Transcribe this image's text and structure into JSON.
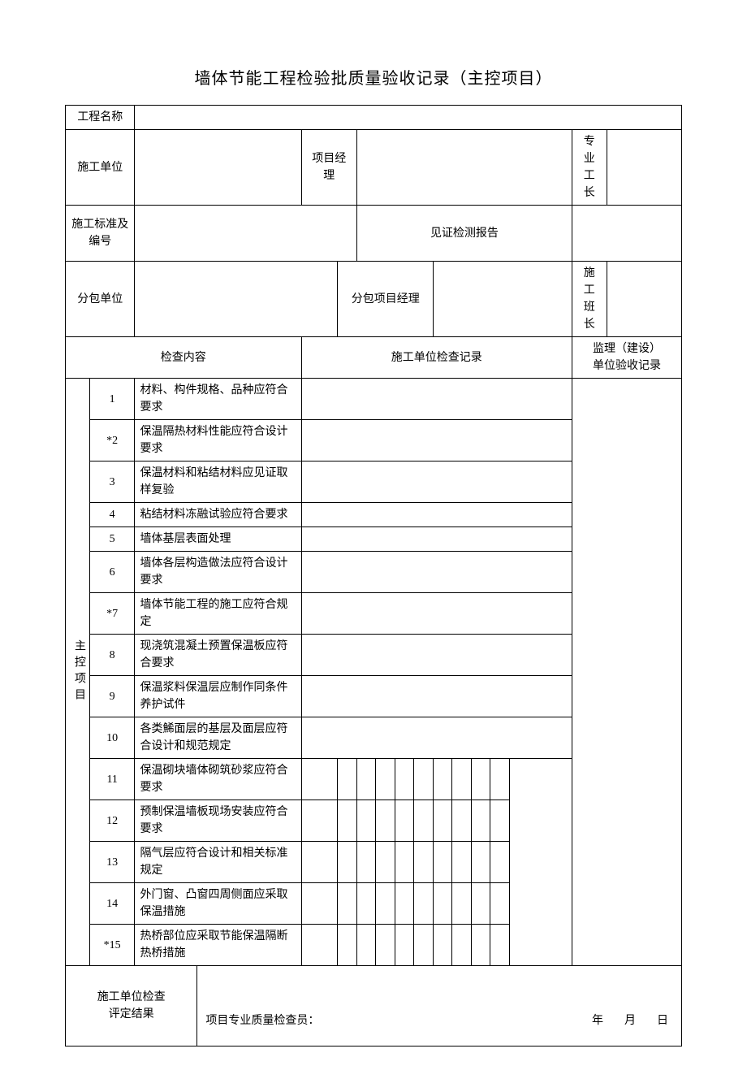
{
  "title": "墙体节能工程检验批质量验收记录（主控项目）",
  "labels": {
    "project_name": "工程名称",
    "construction_unit": "施工单位",
    "project_manager": "项目经理",
    "foreman": "专 业\n工 长",
    "standard_no": "施工标准及编号",
    "witness_report": "见证检测报告",
    "subcontract_unit": "分包单位",
    "sub_project_manager": "分包项目经理",
    "team_leader": "施 工\n班 长",
    "inspection_content": "检查内容",
    "unit_record": "施工单位检查记录",
    "supervisor_record": "监理（建设）\n单位验收记录",
    "main_items": "主控项目",
    "construction_check_result": "施工单位检查\n评定结果",
    "quality_inspector": "项目专业质量检查员：",
    "date": "年　月　日"
  },
  "items": [
    {
      "no": "1",
      "content": "材料、构件规格、品种应符合要求"
    },
    {
      "no": "*2",
      "content": "保温隔热材料性能应符合设计要求"
    },
    {
      "no": "3",
      "content": "保温材料和粘结材料应见证取样复验"
    },
    {
      "no": "4",
      "content": "粘结材料冻融试验应符合要求"
    },
    {
      "no": "5",
      "content": "墙体基层表面处理"
    },
    {
      "no": "6",
      "content": "墙体各层构造做法应符合设计要求"
    },
    {
      "no": "*7",
      "content": "墙体节能工程的施工应符合规定"
    },
    {
      "no": "8",
      "content": "现浇筑混凝土预置保温板应符合要求"
    },
    {
      "no": "9",
      "content": "保温浆料保温层应制作同条件养护试件"
    },
    {
      "no": "10",
      "content": "各类鯑面层的基层及面层应符合设计和规范规定"
    },
    {
      "no": "11",
      "content": "保温砌块墙体砌筑砂浆应符合要求"
    },
    {
      "no": "12",
      "content": "预制保温墙板现场安装应符合要求"
    },
    {
      "no": "13",
      "content": "隔气层应符合设计和相关标准规定"
    },
    {
      "no": "14",
      "content": "外门窗、凸窗四周侧面应采取保温措施"
    },
    {
      "no": "*15",
      "content": "热桥部位应采取节能保温隔断热桥措施"
    }
  ]
}
